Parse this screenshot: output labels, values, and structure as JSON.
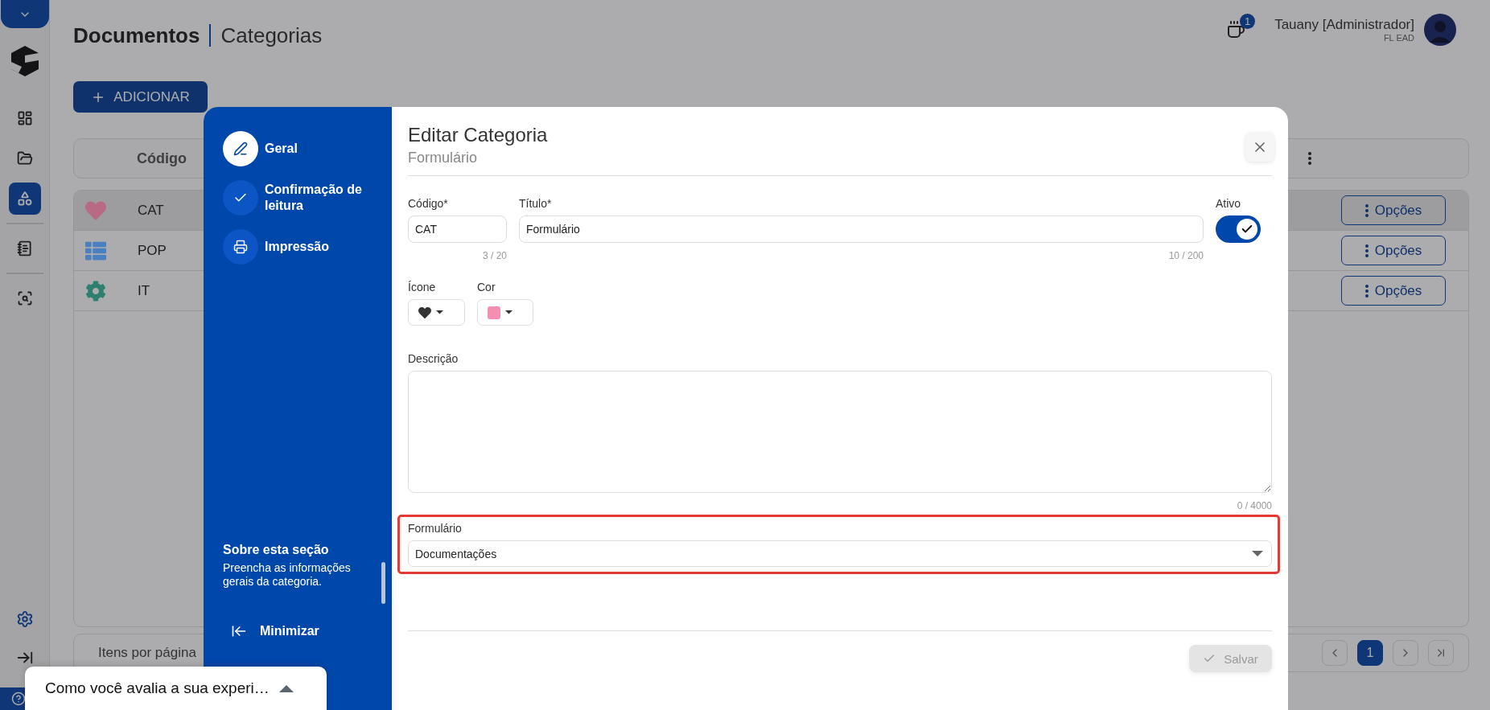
{
  "rail": {
    "items": [
      {
        "kind": "dashboard",
        "selected": false
      },
      {
        "kind": "folder",
        "selected": false
      },
      {
        "kind": "shapes",
        "selected": true
      },
      {
        "kind": "document",
        "selected": false
      },
      {
        "kind": "scan",
        "selected": false
      }
    ]
  },
  "header": {
    "module": "Documentos",
    "page": "Categorias"
  },
  "user": {
    "notifications": "1",
    "name": "Tauany [Administrador]",
    "org": "FL EAD"
  },
  "add_button": "ADICIONAR",
  "table": {
    "columns": [
      "Código"
    ],
    "rows": [
      {
        "kind": "heart",
        "color": "#b86a85",
        "code": "CAT",
        "selected": true,
        "action": "Opções"
      },
      {
        "kind": "list",
        "color": "#4a7fc0",
        "code": "POP",
        "selected": false,
        "action": "Opções"
      },
      {
        "kind": "gear",
        "color": "#2f7f70",
        "code": "IT",
        "selected": false,
        "action": "Opções"
      }
    ]
  },
  "pagination": {
    "label": "Itens por página",
    "pages": [
      {
        "label": "1",
        "selected": true
      }
    ]
  },
  "modal": {
    "steps": [
      {
        "kind": "pen",
        "label": "Geral",
        "selected": true
      },
      {
        "kind": "check",
        "label": "Confirmação de leitura",
        "selected": false
      },
      {
        "kind": "printer",
        "label": "Impressão",
        "selected": false
      }
    ],
    "about": {
      "title": "Sobre esta seção",
      "text": "Preencha as informações gerais da categoria."
    },
    "minimize": "Minimizar",
    "title": "Editar Categoria",
    "subtitle": "Formulário",
    "fields": {
      "codigo": {
        "label": "Código*",
        "value": "CAT",
        "counter": "3 / 20"
      },
      "titulo": {
        "label": "Título*",
        "value": "Formulário",
        "counter": "10 / 200"
      },
      "ativo": {
        "label": "Ativo",
        "on": true
      },
      "icone": {
        "label": "Ícone",
        "kind": "heart"
      },
      "cor": {
        "label": "Cor",
        "color": "#f48fb1"
      },
      "descricao": {
        "label": "Descrição",
        "counter": "0 / 4000"
      },
      "formulario": {
        "label": "Formulário",
        "value": "Documentações",
        "highlighted": true
      }
    },
    "save_button": {
      "label": "Salvar",
      "disabled": true
    }
  },
  "toast": {
    "text": "Como você avalia a sua experi…",
    "expanded": false
  }
}
